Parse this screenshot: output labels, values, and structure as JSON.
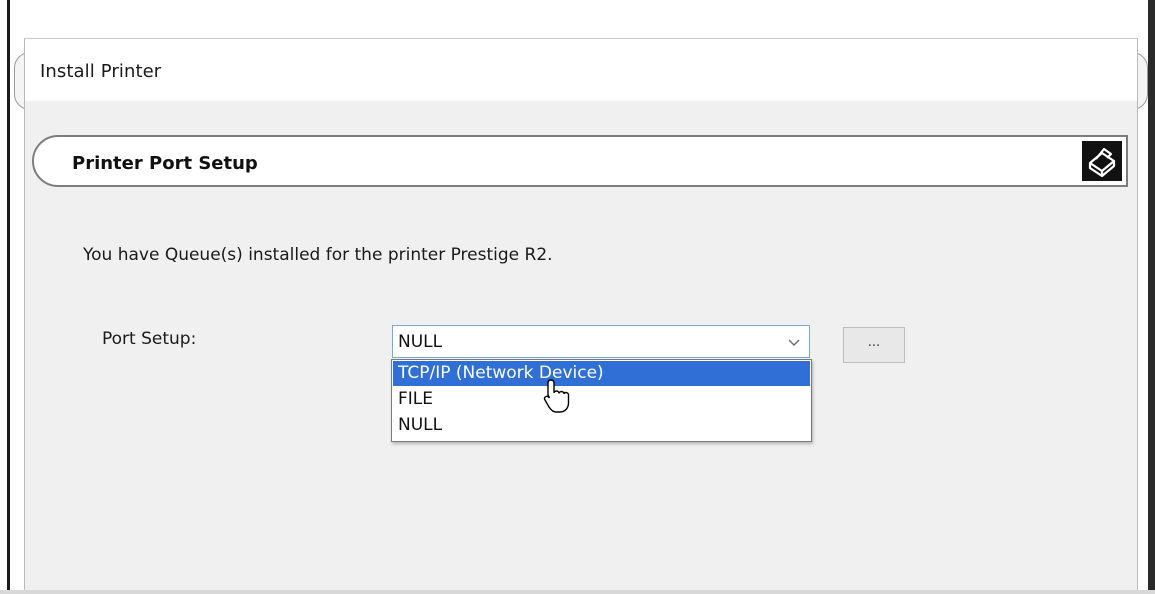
{
  "window": {
    "title": "Install Printer"
  },
  "section": {
    "title": "Printer Port Setup",
    "icon": "printer-icon"
  },
  "message": "You have Queue(s) installed for the printer Prestige R2.",
  "port_setup": {
    "label": "Port Setup:",
    "selected_value": "NULL",
    "options": [
      "TCP/IP (Network Device)",
      "FILE",
      "NULL"
    ],
    "highlighted_option": "TCP/IP (Network Device)",
    "browse_button_label": "..."
  },
  "colors": {
    "selection": "#2f6fd6",
    "combo_border": "#7aa7d6",
    "dialog_bg": "#f0f0f0"
  }
}
